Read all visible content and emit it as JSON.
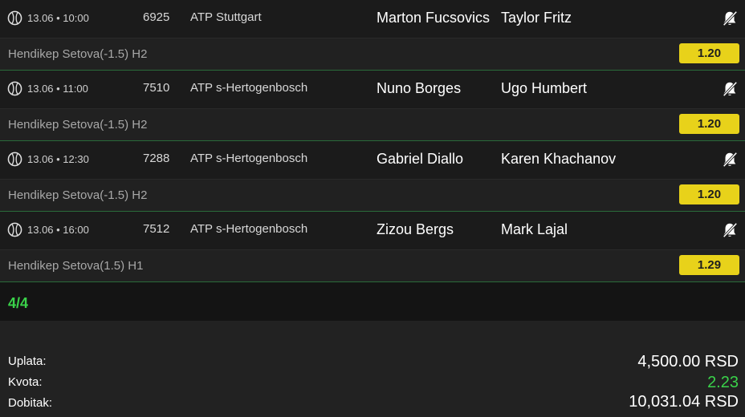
{
  "matches": [
    {
      "time": "13.06 • 10:00",
      "code": "6925",
      "league": "ATP Stuttgart",
      "home": "Marton Fucsovics",
      "away": "Taylor Fritz",
      "market": "Hendikep Setova(-1.5) H2",
      "odd": "1.20",
      "sport_icon": "tennis-ball-icon",
      "bell_icon": "bell-off-icon"
    },
    {
      "time": "13.06 • 11:00",
      "code": "7510",
      "league": "ATP s-Hertogenbosch",
      "home": "Nuno Borges",
      "away": "Ugo Humbert",
      "market": "Hendikep Setova(-1.5) H2",
      "odd": "1.20",
      "sport_icon": "tennis-ball-icon",
      "bell_icon": "bell-off-icon"
    },
    {
      "time": "13.06 • 12:30",
      "code": "7288",
      "league": "ATP s-Hertogenbosch",
      "home": "Gabriel Diallo",
      "away": "Karen Khachanov",
      "market": "Hendikep Setova(-1.5) H2",
      "odd": "1.20",
      "sport_icon": "tennis-ball-icon",
      "bell_icon": "bell-off-icon"
    },
    {
      "time": "13.06 • 16:00",
      "code": "7512",
      "league": "ATP s-Hertogenbosch",
      "home": "Zizou Bergs",
      "away": "Mark Lajal",
      "market": "Hendikep Setova(1.5) H1",
      "odd": "1.29",
      "sport_icon": "tennis-ball-icon",
      "bell_icon": "bell-off-icon"
    }
  ],
  "counter": "4/4",
  "summary": {
    "stake_label": "Uplata:",
    "stake_value": "4,500.00 RSD",
    "odds_label": "Kvota:",
    "odds_value": "2.23",
    "win_label": "Dobitak:",
    "win_value": "10,031.04 RSD"
  },
  "colors": {
    "odd_bg": "#e8d21a",
    "accent_green": "#3ad24a",
    "background": "#1c1c1c"
  }
}
